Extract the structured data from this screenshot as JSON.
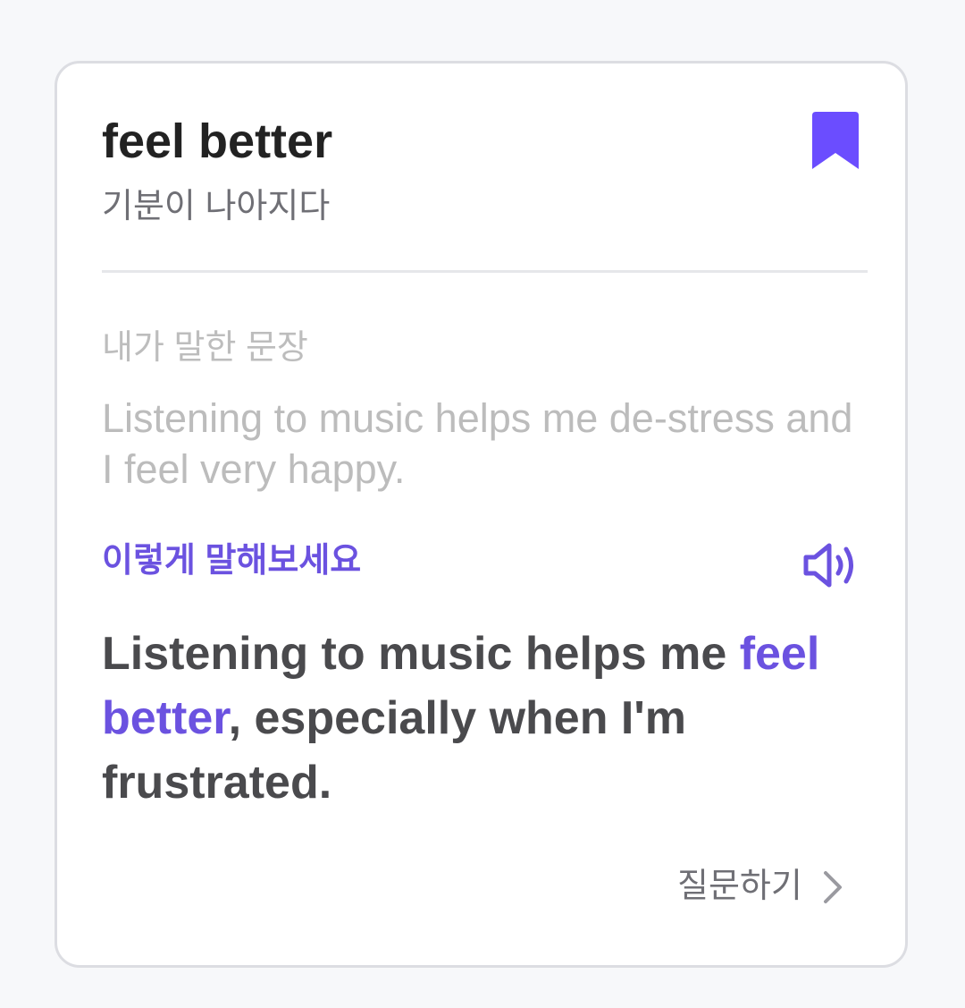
{
  "card": {
    "word": "feel better",
    "meaning": "기분이 나아지다",
    "my_sentence_label": "내가 말한 문장",
    "my_sentence": "Listening to music helps me de-stress and I feel very happy.",
    "suggestion_label": "이렇게 말해보세요",
    "suggestion": {
      "before": "Listening to music helps me ",
      "highlight": "feel better",
      "after": ", especially when I'm frustrated."
    },
    "ask_label": "질문하기"
  },
  "icons": {
    "bookmark": "bookmark-filled-icon",
    "speaker": "speaker-volume-icon",
    "chevron": "chevron-right-icon"
  },
  "colors": {
    "accent": "#6b52e0",
    "bookmark": "#6b4dff",
    "title": "#222222",
    "muted": "#bdbdbd",
    "body": "#4a4a4d"
  }
}
